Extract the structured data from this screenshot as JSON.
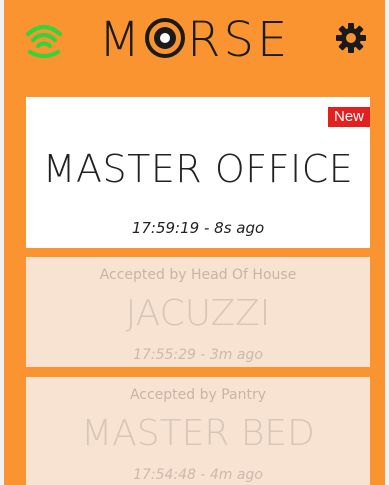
{
  "header": {
    "brand_prefix": "M",
    "brand_suffix": "RSE",
    "brand_full": "MORSE",
    "connection_icon": "wifi-icon",
    "settings_icon": "gear-icon",
    "colors": {
      "header_bg": "#f99430",
      "wifi": "#2fd63a",
      "brand_text": "#1a1a1a"
    }
  },
  "calls": [
    {
      "title": "MASTER OFFICE",
      "time": "17:59:19 - 8s ago",
      "badge": "New",
      "status": "new"
    },
    {
      "accepted_by": "Accepted by Head Of House",
      "title": "JACUZZI",
      "time": "17:55:29 - 3m ago",
      "status": "accepted"
    },
    {
      "accepted_by": "Accepted by Pantry",
      "title": "MASTER BED",
      "time": "17:54:48 - 4m ago",
      "status": "accepted"
    }
  ],
  "colors": {
    "background": "#f99430",
    "new_card": "#ffffff",
    "accepted_card": "#f8e3d2",
    "badge": "#e41f1f"
  }
}
